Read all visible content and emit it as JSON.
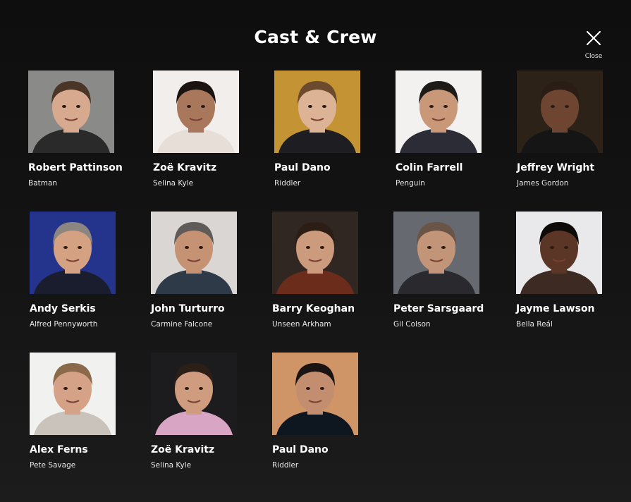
{
  "modal": {
    "title": "Cast & Crew",
    "close_label": "Close"
  },
  "cast": [
    {
      "name": "Robert Pattinson",
      "role": "Batman",
      "bg": "#8a8a88",
      "skin": "#d7a98e",
      "hair": "#4a3526",
      "shirt": "#2a2a2a"
    },
    {
      "name": "Zoë Kravitz",
      "role": "Selina Kyle",
      "bg": "#f1eeec",
      "skin": "#a9785c",
      "hair": "#1b1310",
      "shirt": "#e8ded8"
    },
    {
      "name": "Paul Dano",
      "role": "Riddler",
      "bg": "#c49334",
      "skin": "#dcb394",
      "hair": "#6b4a2e",
      "shirt": "#1e1e22"
    },
    {
      "name": "Colin Farrell",
      "role": "Penguin",
      "bg": "#f2f1ef",
      "skin": "#c99878",
      "hair": "#1e1a18",
      "shirt": "#2c2c36"
    },
    {
      "name": "Jeffrey Wright",
      "role": "James Gordon",
      "bg": "#2c2217",
      "skin": "#6d4530",
      "hair": "#2a1d16",
      "shirt": "#151515"
    },
    {
      "name": "Andy Serkis",
      "role": "Alfred Pennyworth",
      "bg": "#24348d",
      "skin": "#d4a283",
      "hair": "#8b8680",
      "shirt": "#1a1d2e"
    },
    {
      "name": "John Turturro",
      "role": "Carmine Falcone",
      "bg": "#d9d6d3",
      "skin": "#c69274",
      "hair": "#5e5b58",
      "shirt": "#2f3a48"
    },
    {
      "name": "Barry Keoghan",
      "role": "Unseen Arkham",
      "bg": "#302622",
      "skin": "#cc9a7c",
      "hair": "#2c1d15",
      "shirt": "#6b2c1c"
    },
    {
      "name": "Peter Sarsgaard",
      "role": "Gil Colson",
      "bg": "#666a70",
      "skin": "#c39578",
      "hair": "#6a5445",
      "shirt": "#2a2a2e"
    },
    {
      "name": "Jayme Lawson",
      "role": "Bella Reál",
      "bg": "#e9e9eb",
      "skin": "#5b3626",
      "hair": "#0f0b09",
      "shirt": "#3d2a22"
    },
    {
      "name": "Alex Ferns",
      "role": "Pete Savage",
      "bg": "#f1f1ef",
      "skin": "#d6a287",
      "hair": "#8a6a4a",
      "shirt": "#c9c3bb"
    },
    {
      "name": "Zoë Kravitz",
      "role": "Selina Kyle",
      "bg": "#1c1c1e",
      "skin": "#cf9c80",
      "hair": "#2b1f18",
      "shirt": "#d9a5c4"
    },
    {
      "name": "Paul Dano",
      "role": "Riddler",
      "bg": "#d09567",
      "skin": "#c38d70",
      "hair": "#1a1412",
      "shirt": "#0e1620"
    }
  ]
}
